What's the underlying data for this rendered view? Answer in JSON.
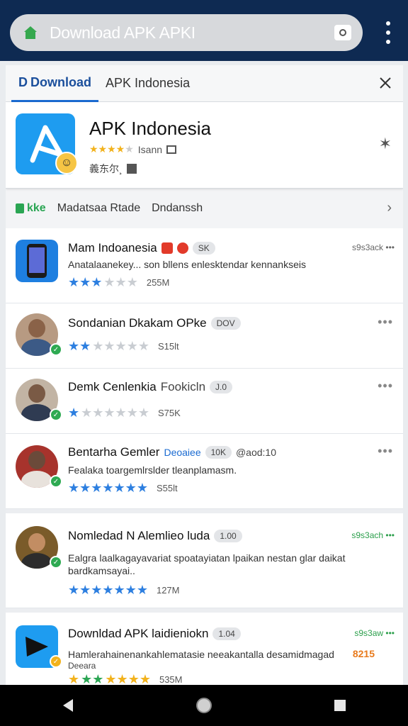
{
  "browser": {
    "url_text": "Download APK APKI",
    "home_icon": "home-icon",
    "tab_icon": "tab-switcher-icon",
    "menu_icon": "overflow-menu-icon"
  },
  "tabs": {
    "active": {
      "prefix": "D",
      "label": "Download"
    },
    "second": "APK Indonesia",
    "close_icon": "close-icon"
  },
  "app": {
    "title": "APK Indonesia",
    "rating_text": "Isann",
    "sub_text": "義东尔¸",
    "pin_icon": "pin-icon"
  },
  "subtabs": {
    "first": "kke",
    "second": "Madatsaa Rtade",
    "third": "Dndanssh"
  },
  "items": [
    {
      "name": "Mam Indoanesia",
      "chip": "SK",
      "meta": "s9s3ack",
      "desc": "Anatalaanekey... son bllens enlesktendar kennankseis",
      "rating": 3,
      "size": "255M"
    },
    {
      "name": "Sondanian Dkakam OPke",
      "chip": "DOV",
      "meta": "",
      "desc": "",
      "rating": 2,
      "size": "S15lt"
    },
    {
      "name": "Demk Cenlenkia",
      "name_extra": "Fookicln",
      "chip": "J.0",
      "meta": "",
      "desc": "",
      "rating": 1,
      "size": "S75K"
    },
    {
      "name": "Bentarha Gemler",
      "name_link": "Deoaiee",
      "chip": "10K",
      "extra": "@aod:10",
      "meta": "",
      "desc": "Fealaka toargemlrslder tleanplamasm.",
      "rating": 7,
      "size": "S55lt"
    },
    {
      "name": "Nomledad N Alemlieo luda",
      "chip": "1.00",
      "meta": "s9s3ach",
      "desc": "Ealgra laalkagayavariat spoatayiatan lpaikan nestan glar daikat bardkamsayai..",
      "rating": 7,
      "size": "127M"
    },
    {
      "name": "Downldad APK laidieniokn",
      "chip": "1.04",
      "meta": "s9s3aw",
      "desc": "Hamlerahainenankahlematasie neeakantalla desamidmagad",
      "desc2": "Deeara",
      "badge": "8215",
      "rating": 7,
      "size": "535M"
    }
  ],
  "navbar": {
    "back": "back-icon",
    "home": "home-circle-icon",
    "recents": "recents-icon"
  },
  "colors": {
    "topbar": "#0e2a52",
    "accent": "#1b6bd1",
    "star": "#2d7fe0",
    "green": "#2eaa52"
  }
}
